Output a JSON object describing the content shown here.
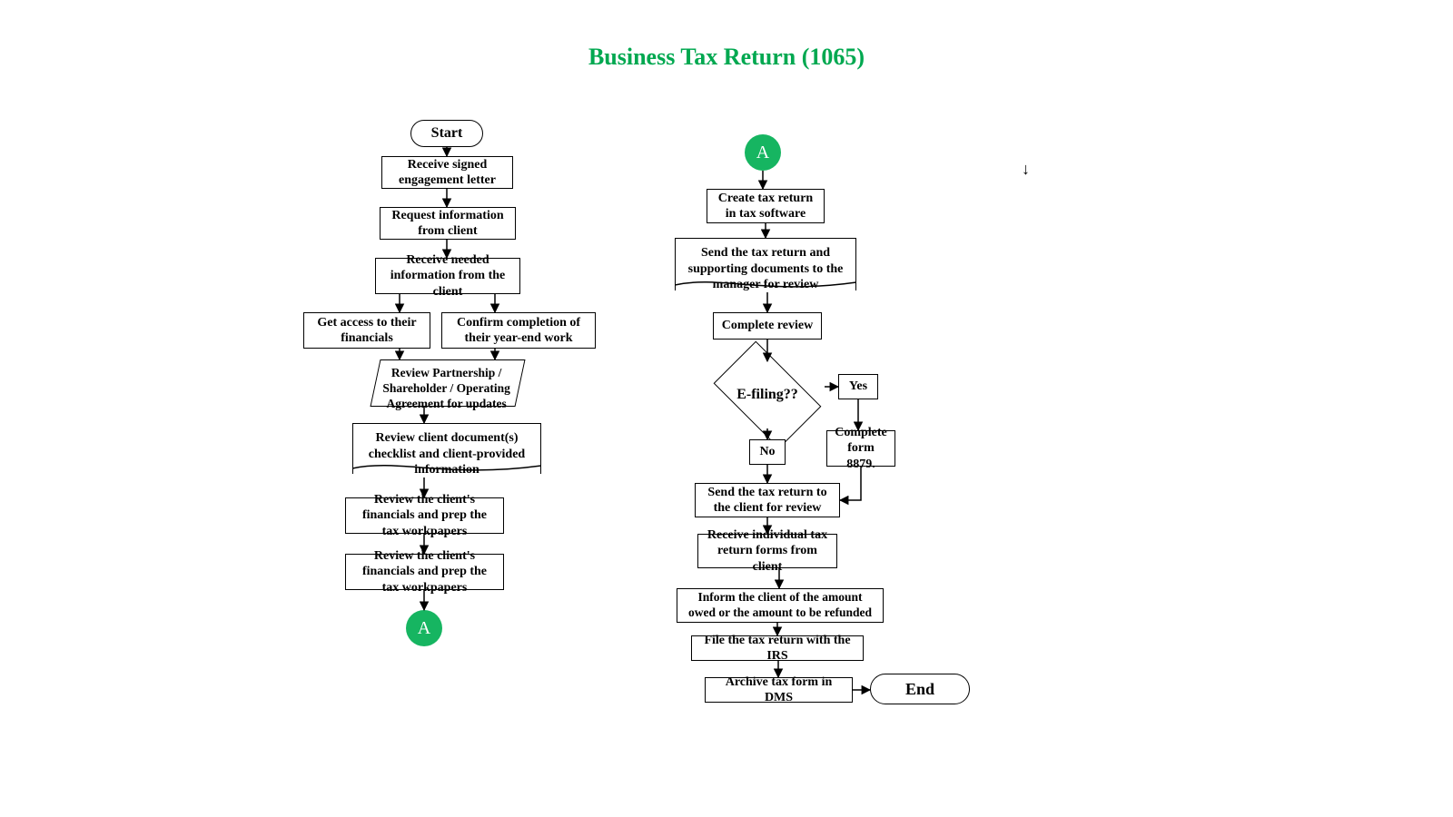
{
  "title": "Business Tax Return (1065)",
  "connector_label": "A",
  "left": {
    "start": "Start",
    "n1": "Receive signed engagement letter",
    "n2": "Request information from client",
    "n3": "Receive needed information from the client",
    "n4a": "Get access to their financials",
    "n4b": "Confirm completion of their year-end work",
    "n5": "Review Partnership / Shareholder / Operating Agreement for updates",
    "n6": "Review client document(s) checklist and client-provided information",
    "n7": "Review the client's financials and prep the tax workpapers",
    "n8": "Review the client's financials and prep the tax workpapers"
  },
  "right": {
    "r1": "Create tax return in tax software",
    "r2": "Send the tax return and supporting documents to the manager for review",
    "r3": "Complete review",
    "decision": "E-filing??",
    "yes_label": "Yes",
    "no_label": "No",
    "r_yes": "Complete form 8879.",
    "r4": "Send the tax return to the client for review",
    "r5": "Receive individual tax return forms from client",
    "r6": "Inform the client of the amount owed or the amount to be refunded",
    "r7": "File the tax return with the IRS",
    "r8": "Archive tax form in DMS",
    "end": "End"
  }
}
